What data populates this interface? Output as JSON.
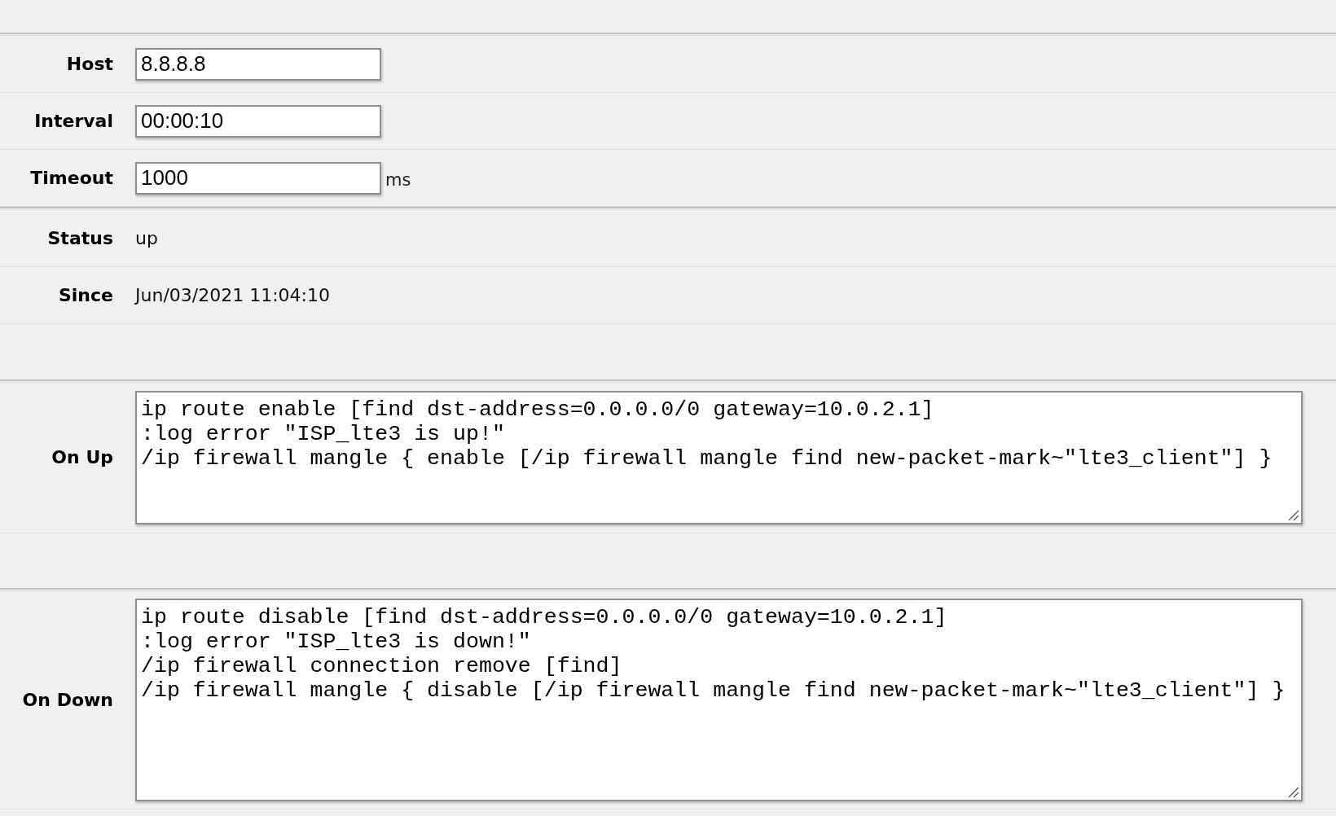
{
  "settings": [
    {
      "label": "Host",
      "kind": "input",
      "value": "8.8.8.8"
    },
    {
      "label": "Interval",
      "kind": "input",
      "value": "00:00:10"
    },
    {
      "label": "Timeout",
      "kind": "input",
      "value": "1000",
      "unit": "ms"
    }
  ],
  "status": [
    {
      "label": "Status",
      "value": "up"
    },
    {
      "label": "Since",
      "value": "Jun/03/2021 11:04:10"
    }
  ],
  "scripts": [
    {
      "label": "On Up",
      "lines": [
        "ip route enable [find dst-address=0.0.0.0/0 gateway=10.0.2.1]",
        ":log error \"ISP_lte3 is up!\"",
        "/ip firewall mangle { enable [/ip firewall mangle find new-packet-mark~\"lte3_client\"] }"
      ]
    },
    {
      "label": "On Down",
      "lines": [
        "ip route disable [find dst-address=0.0.0.0/0 gateway=10.0.2.1]",
        ":log error \"ISP_lte3 is down!\"",
        "/ip firewall connection remove [find]",
        "/ip firewall mangle { disable [/ip firewall mangle find new-packet-mark~\"lte3_client\"] }"
      ]
    }
  ]
}
